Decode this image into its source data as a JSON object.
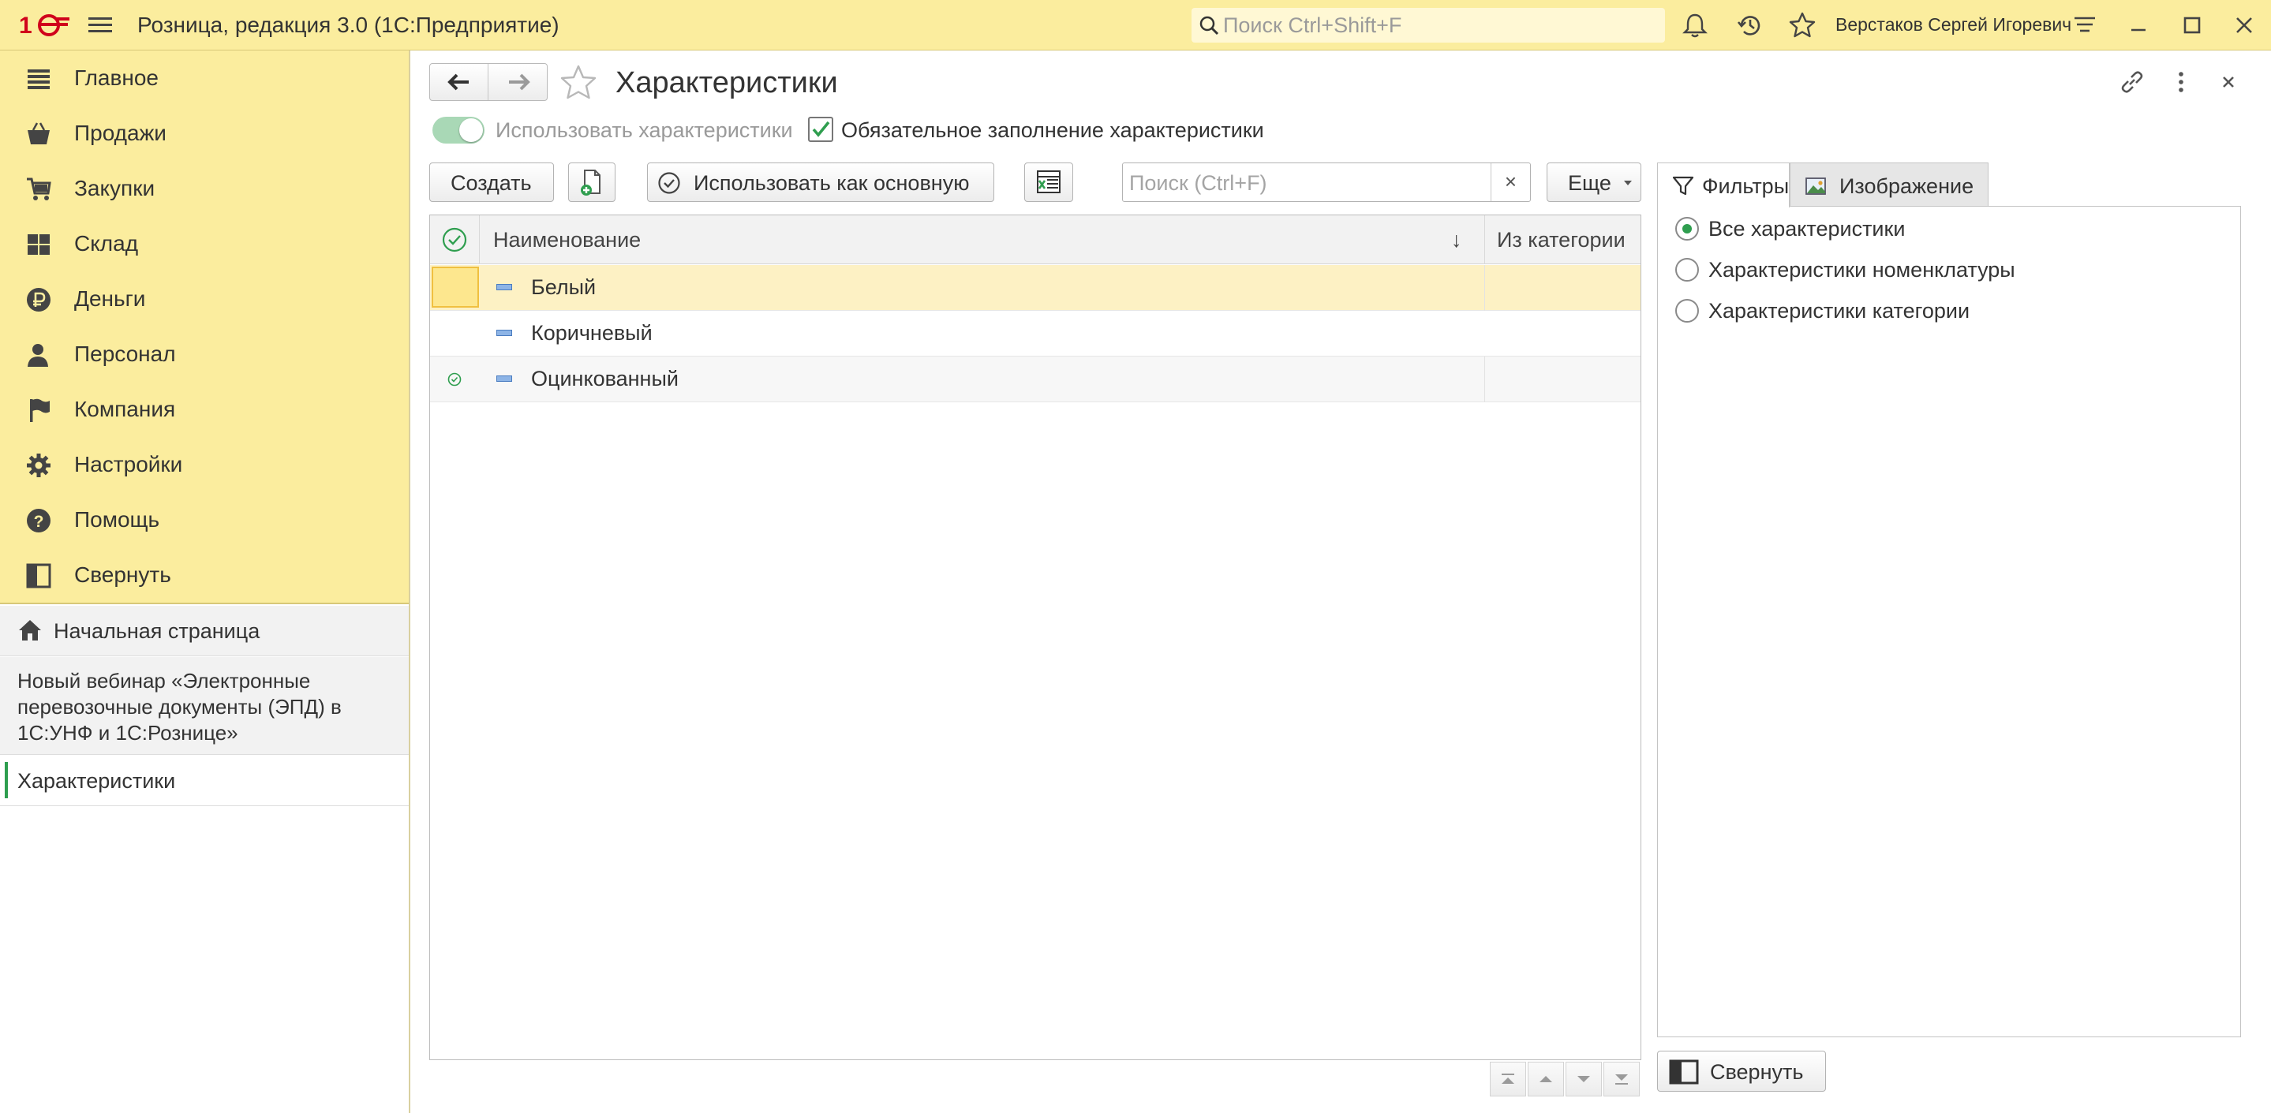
{
  "app": {
    "title": "Розница, редакция 3.0  (1С:Предприятие)",
    "search_placeholder": "Поиск Ctrl+Shift+F",
    "user": "Верстаков Сергей Игоревич",
    "brand_color": "#d0021b"
  },
  "sidebar": {
    "menu": [
      {
        "label": "Главное",
        "icon": "list-icon"
      },
      {
        "label": "Продажи",
        "icon": "basket-icon"
      },
      {
        "label": "Закупки",
        "icon": "cart-icon"
      },
      {
        "label": "Склад",
        "icon": "warehouse-icon"
      },
      {
        "label": "Деньги",
        "icon": "ruble-icon"
      },
      {
        "label": "Персонал",
        "icon": "person-icon"
      },
      {
        "label": "Компания",
        "icon": "flag-icon"
      },
      {
        "label": "Настройки",
        "icon": "gear-icon"
      },
      {
        "label": "Помощь",
        "icon": "help-icon"
      },
      {
        "label": "Свернуть",
        "icon": "collapse-panel-icon"
      }
    ],
    "home": "Начальная страница",
    "webinar": "Новый вебинар «Электронные перевозочные документы (ЭПД) в 1С:УНФ и 1С:Рознице»",
    "active_tab": "Характеристики"
  },
  "form": {
    "title": "Характеристики",
    "use_characteristics_label": "Использовать характеристики",
    "use_characteristics_on": true,
    "mandatory_fill_label": "Обязательное заполнение характеристики",
    "mandatory_fill_checked": true,
    "buttons": {
      "create": "Создать",
      "use_as_main": "Использовать как основную",
      "more": "Еще"
    },
    "search_placeholder": "Поиск (Ctrl+F)",
    "table": {
      "columns": [
        "Наименование",
        "Из категории"
      ],
      "sort_indicator": "↓",
      "rows": [
        {
          "name": "Белый",
          "from_category": "",
          "is_main": false,
          "selected": true
        },
        {
          "name": "Коричневый",
          "from_category": "",
          "is_main": false,
          "selected": false
        },
        {
          "name": "Оцинкованный",
          "from_category": "",
          "is_main": true,
          "selected": false
        }
      ]
    },
    "right_panel": {
      "tabs": [
        "Фильтры",
        "Изображение"
      ],
      "active_tab": "Фильтры",
      "filter_options": [
        {
          "label": "Все характеристики",
          "selected": true
        },
        {
          "label": "Характеристики номенклатуры",
          "selected": false
        },
        {
          "label": "Характеристики категории",
          "selected": false
        }
      ],
      "collapse_label": "Свернуть"
    }
  }
}
